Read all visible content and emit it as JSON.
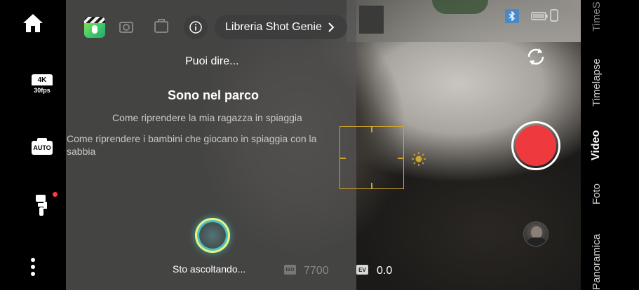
{
  "left_rail": {
    "home_icon": "home-icon",
    "resolution": {
      "top": "4K",
      "bottom": "30fps"
    },
    "camera_mode_label": "AUTO",
    "gimbal_icon": "gimbal-icon",
    "more_icon": "more-vertical-icon"
  },
  "shot_genie": {
    "library_label": "Libreria Shot Genie",
    "prompt_title": "Puoi dire...",
    "suggestion_main": "Sono nel parco",
    "suggestion_1": "Come riprendere la mia ragazza in spiaggia",
    "suggestion_2": "Come riprendere i bambini che giocano in spiaggia con la sabbia",
    "listening_text": "Sto ascoltando..."
  },
  "readouts": {
    "iso_label": "ISO",
    "wb_value": "7700",
    "ev_label": "EV",
    "ev_value": "0.0"
  },
  "modes": [
    "Timelapse",
    "Video",
    "Foto",
    "Panoramica"
  ],
  "mode_partial_top": "TimeS",
  "active_mode": "Video",
  "colors": {
    "record": "#ee3a3f",
    "focus": "#d1a52a",
    "bluetooth": "#4a89c7"
  }
}
